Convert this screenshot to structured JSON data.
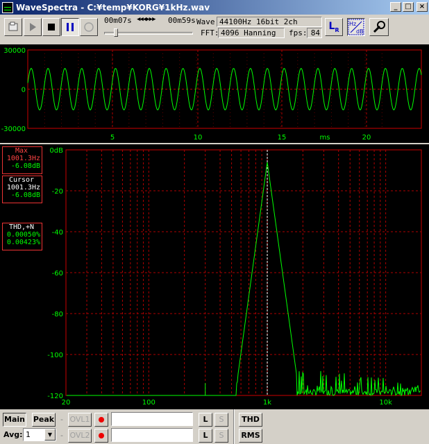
{
  "window": {
    "title": "WaveSpectra - C:¥temp¥KORG¥1kHz.wav",
    "min": "_",
    "max": "□",
    "close": "×"
  },
  "toolbar": {
    "time_pos": "00m07s",
    "time_total": "00m59s",
    "seek_icons": "◀◀◀▶▶▶",
    "wave_label": "Wave:",
    "wave_value": "44100Hz 16bit 2ch",
    "fft_label": "FFT:",
    "fft_value": "4096 Hanning",
    "fps_label": "fps:",
    "fps_value": "84",
    "lr_label": "L",
    "lr_sub": "R",
    "hz_label": "Hz",
    "db_label": "dB"
  },
  "scope": {
    "yticks": [
      "30000",
      "0",
      "-30000"
    ],
    "xticks": [
      "5",
      "10",
      "15",
      "20"
    ],
    "unit": "ms",
    "trace_color": "#00ff00",
    "grid_color": "#b00000"
  },
  "spectrum": {
    "yticks": [
      "0dB",
      "-20",
      "-40",
      "-60",
      "-80",
      "-100",
      "-120"
    ],
    "xticks": [
      "20",
      "100",
      "1k",
      "10k"
    ],
    "trace_color": "#00ff00",
    "grid_color": "#b00000"
  },
  "info": {
    "max_title": "Max",
    "max_freq": "1001.3Hz",
    "max_db": "-6.08dB",
    "cursor_title": "Cursor",
    "cursor_freq": "1001.3Hz",
    "cursor_db": "-6.08dB",
    "thd_title": "THD,+N",
    "thd_value": "0.00050%",
    "thdn_value": "0.00423%"
  },
  "bottom": {
    "main": "Main",
    "peak": "Peak",
    "ovl1": "OVL1",
    "ovl2": "OVL2",
    "l": "L",
    "s": "S",
    "thd": "THD",
    "rms": "RMS",
    "avg_label": "Avg:",
    "avg_value": "1",
    "dash": "-"
  }
}
